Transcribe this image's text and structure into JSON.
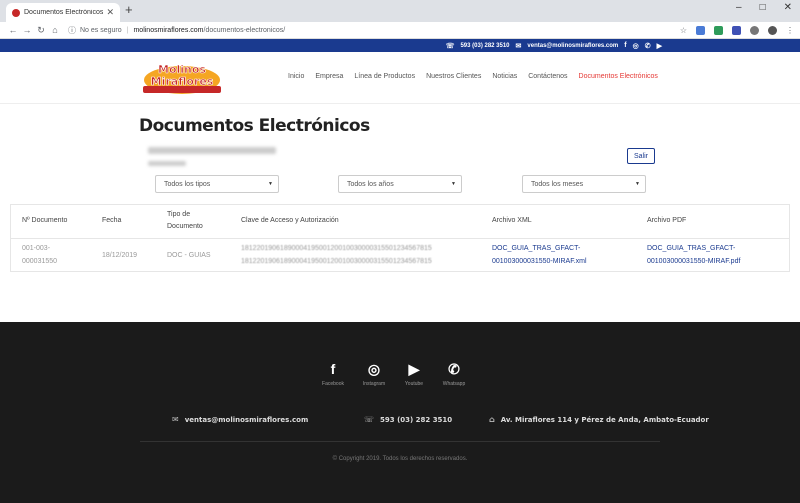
{
  "browser": {
    "tab_title": "Documentos Electrónicos - Moli",
    "new_tab": "+",
    "insecure_label": "No es seguro",
    "url_host": "molinosmiraflores.com",
    "url_path": "/documentos-electronicos/",
    "win_minimize": "–",
    "win_maximize": "□",
    "win_close": "✕"
  },
  "topbar": {
    "phone": "593 (03) 282 3510",
    "email": "ventas@molinosmiraflores.com"
  },
  "logo": {
    "line1": "Molinos",
    "line2": "Miraflores"
  },
  "nav": [
    "Inicio",
    "Empresa",
    "Línea de Productos",
    "Nuestros Clientes",
    "Noticias",
    "Contáctenos",
    "Documentos Electrónicos"
  ],
  "page": {
    "title": "Documentos Electrónicos",
    "logout": "Salir"
  },
  "filters": {
    "types": "Todos los tipos",
    "years": "Todos los años",
    "months": "Todos los meses"
  },
  "table": {
    "headers": {
      "number": "Nº Documento",
      "date": "Fecha",
      "type_line1": "Tipo de",
      "type_line2": "Documento",
      "key": "Clave de Acceso y Autorización",
      "xml": "Archivo XML",
      "pdf": "Archivo PDF"
    },
    "row": {
      "number_line1": "001-003-",
      "number_line2": "000031550",
      "date": "18/12/2019",
      "type": "DOC - GUIAS",
      "key_line1": "1812201906189000419500120010030000315501234567815",
      "key_line2": "1812201906189000419500120010030000315501234567815",
      "xml_line1": "DOC_GUIA_TRAS_GFACT-",
      "xml_line2": "001003000031550-MIRAF.xml",
      "pdf_line1": "DOC_GUIA_TRAS_GFACT-",
      "pdf_line2": "001003000031550-MIRAF.pdf"
    }
  },
  "footer": {
    "social": [
      {
        "icon": "facebook-icon",
        "label": "Facebook"
      },
      {
        "icon": "instagram-icon",
        "label": "Instagram"
      },
      {
        "icon": "youtube-icon",
        "label": "Youtube"
      },
      {
        "icon": "whatsapp-icon",
        "label": "Whatsapp"
      }
    ],
    "email": "ventas@molinosmiraflores.com",
    "phone": "593 (03) 282 3510",
    "address": "Av. Miraflores 114 y Pérez de Anda, Ambato-Ecuador",
    "copyright": "© Copyright 2019. Todos los derechos reservados."
  },
  "colors": {
    "brand_blue": "#1a3a8f",
    "active_red": "#e53935",
    "footer_bg": "#1b1b1b"
  }
}
